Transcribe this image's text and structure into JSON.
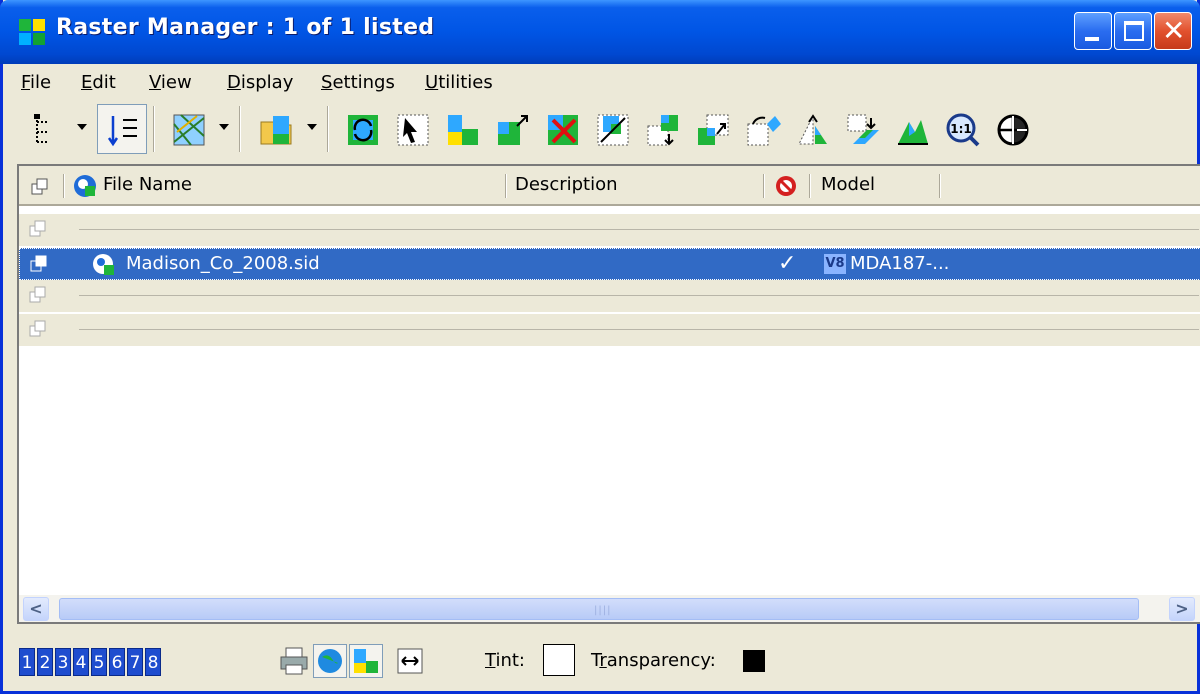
{
  "window": {
    "title": "Raster Manager : 1 of 1 listed",
    "minimize": "minimize",
    "maximize": "maximize",
    "close": "✕"
  },
  "menu": {
    "file": {
      "u": "F",
      "rest": "ile"
    },
    "edit": {
      "u": "E",
      "rest": "dit"
    },
    "view": {
      "u": "V",
      "rest": "iew"
    },
    "display": {
      "u": "D",
      "rest": "isplay"
    },
    "settings": {
      "u": "S",
      "rest": "ettings"
    },
    "utilities": {
      "u": "U",
      "rest": "tilities"
    }
  },
  "columns": {
    "file_name": "File Name",
    "description": "Description",
    "model": "Model"
  },
  "rows": [
    {
      "file_name": "",
      "description": "",
      "model": ""
    },
    {
      "file_name": "Madison_Co_2008.sid",
      "description": "",
      "check": "✓",
      "model_badge": "V8",
      "model": "MDA187-..."
    },
    {
      "file_name": "",
      "description": "",
      "model": ""
    },
    {
      "file_name": "",
      "description": "",
      "model": ""
    }
  ],
  "scrollbar": {
    "left": "<",
    "right": ">",
    "grip": "||||"
  },
  "status": {
    "views": [
      "1",
      "2",
      "3",
      "4",
      "5",
      "6",
      "7",
      "8"
    ],
    "tint_label_u": "T",
    "tint_label_rest": "int:",
    "transparency_label_pre": "T",
    "transparency_label_u": "r",
    "transparency_label_rest": "ansparency:",
    "tint_color": "#ffffff",
    "transparency_color": "#000000"
  },
  "colors": {
    "title_bar": "#0055e5",
    "selection": "#316ac5",
    "chrome": "#ece9d8"
  }
}
